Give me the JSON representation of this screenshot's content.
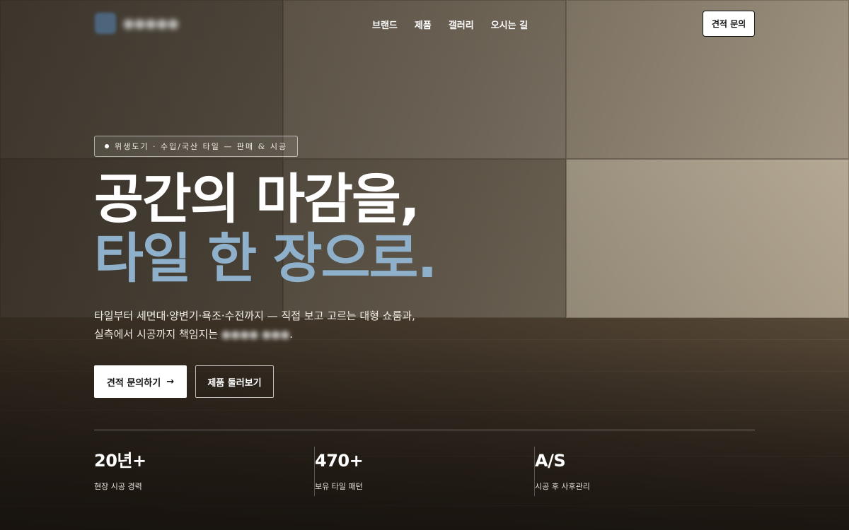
{
  "header": {
    "brand_name": "●●●●●",
    "nav": [
      "브랜드",
      "제품",
      "갤러리",
      "오시는 길"
    ],
    "cta_label": "견적 문의"
  },
  "hero": {
    "badge": "위생도기 · 수입/국산 타일 — 판매 & 시공",
    "headline_line1": "공간의 마감을,",
    "headline_line2": "타일 한 장으로.",
    "description_line1": "타일부터 세면대·양변기·욕조·수전까지 — 직접 보고 고르는 대형 쇼룸과,",
    "description_line2_prefix": "실측에서 시공까지 책임지는 ",
    "description_line2_blurred": "●●●● ●●●",
    "description_line2_suffix": ".",
    "primary_button": "견적 문의하기",
    "primary_button_arrow": "→",
    "secondary_button": "제품 둘러보기"
  },
  "stats": [
    {
      "value": "20년+",
      "label": "현장 시공 경력"
    },
    {
      "value": "470+",
      "label": "보유 타일 패턴"
    },
    {
      "value": "A/S",
      "label": "시공 후 사후관리"
    }
  ],
  "colors": {
    "accent": "#8fb0ca",
    "primary_button_bg": "#ffffff",
    "text": "#ffffff"
  }
}
